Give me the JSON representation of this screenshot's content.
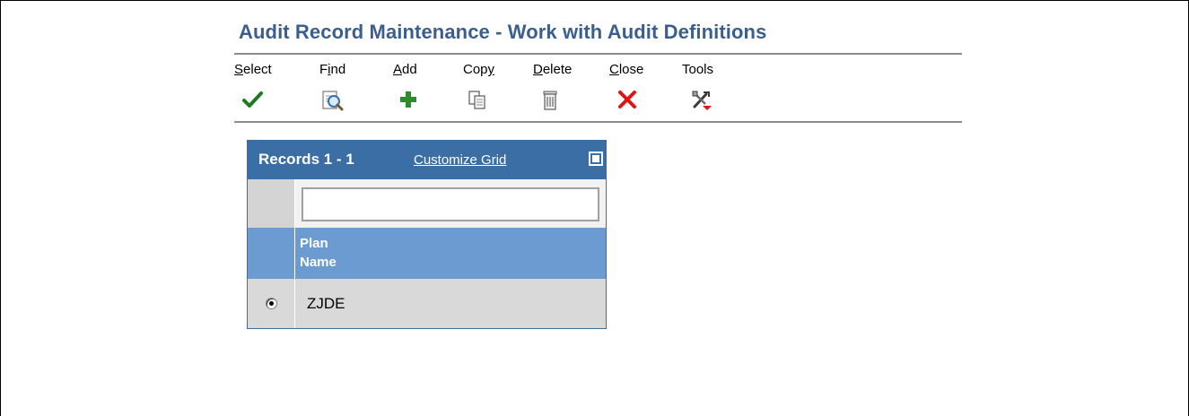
{
  "form": {
    "title": "Audit Record Maintenance - Work with Audit Definitions"
  },
  "toolbar": {
    "items": [
      {
        "label": "Select",
        "mnemonic": "S",
        "icon": "checkmark-icon"
      },
      {
        "label": "Find",
        "mnemonic": "i",
        "icon": "find-magnifier-icon"
      },
      {
        "label": "Add",
        "mnemonic": "A",
        "icon": "plus-icon"
      },
      {
        "label": "Copy",
        "mnemonic": "y",
        "icon": "copy-icon"
      },
      {
        "label": "Delete",
        "mnemonic": "D",
        "icon": "trash-icon"
      },
      {
        "label": "Close",
        "mnemonic": "C",
        "icon": "close-x-icon"
      },
      {
        "label": "Tools",
        "mnemonic": "",
        "icon": "tools-icon"
      }
    ]
  },
  "grid": {
    "records_label": "Records 1 - 1",
    "customize_label": "Customize Grid",
    "filter_value": "",
    "columns": [
      {
        "label_line1": "Plan",
        "label_line2": "Name"
      }
    ],
    "rows": [
      {
        "selected": true,
        "plan_name": "ZJDE"
      }
    ]
  },
  "colors": {
    "title": "#3a5f8f",
    "grid_header": "#3b6ea5",
    "column_header": "#6b9bd1",
    "row_background": "#d9d9d9",
    "add_icon": "#2e8b2e",
    "close_icon": "#e01414",
    "select_icon": "#1f7a1f"
  }
}
